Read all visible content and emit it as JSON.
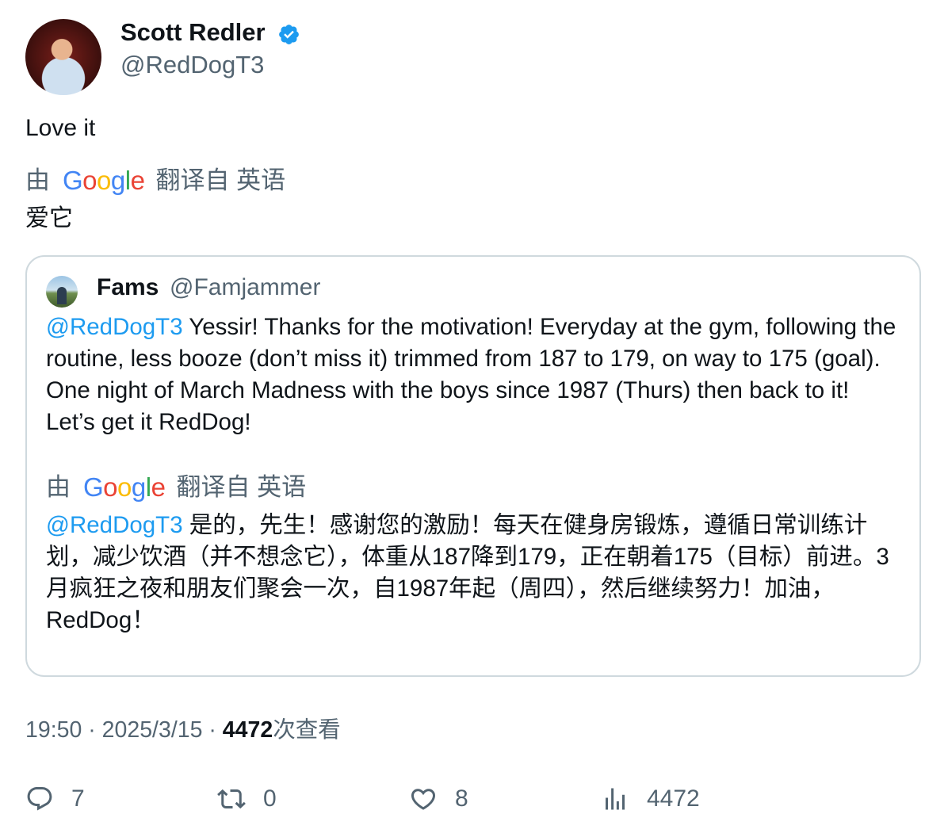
{
  "author": {
    "name": "Scott Redler",
    "handle": "@RedDogT3",
    "verified": true
  },
  "tweet": {
    "text": "Love it",
    "translation_prefix": "由",
    "translation_brand": "Google",
    "translation_label": "翻译自 英语",
    "translated_text": "爱它"
  },
  "quote": {
    "name": "Fams",
    "handle": "@Famjammer",
    "mention": "@RedDogT3",
    "text": " Yessir!  Thanks for the motivation!  Everyday at the gym, following the routine, less booze (don’t miss it) trimmed from 187 to 179, on way to 175 (goal). One night of March Madness with the boys since 1987 (Thurs) then back to it!  Let’s get it RedDog!",
    "translation_prefix": "由",
    "translation_brand": "Google",
    "translation_label": "翻译自 英语",
    "translated_mention": "@RedDogT3",
    "translated_text": " 是的，先生！感谢您的激励！每天在健身房锻炼，遵循日常训练计划，减少饮酒（并不想念它），体重从187降到179，正在朝着175（目标）前进。3月疯狂之夜和朋友们聚会一次，自1987年起（周四），然后继续努力！加油，RedDog！"
  },
  "meta": {
    "time": "19:50",
    "separator": " · ",
    "date": "2025/3/15",
    "views_count": "4472",
    "views_label": "次查看"
  },
  "actions": {
    "replies": "7",
    "retweets": "0",
    "likes": "8",
    "views": "4472"
  },
  "icons": {
    "verified": "verified-badge-icon",
    "reply": "reply-icon",
    "retweet": "retweet-icon",
    "like": "heart-icon",
    "views": "analytics-icon"
  },
  "colors": {
    "accent": "#1d9bf0",
    "muted": "#536471",
    "text": "#0f1419",
    "border": "#cfd9de"
  }
}
